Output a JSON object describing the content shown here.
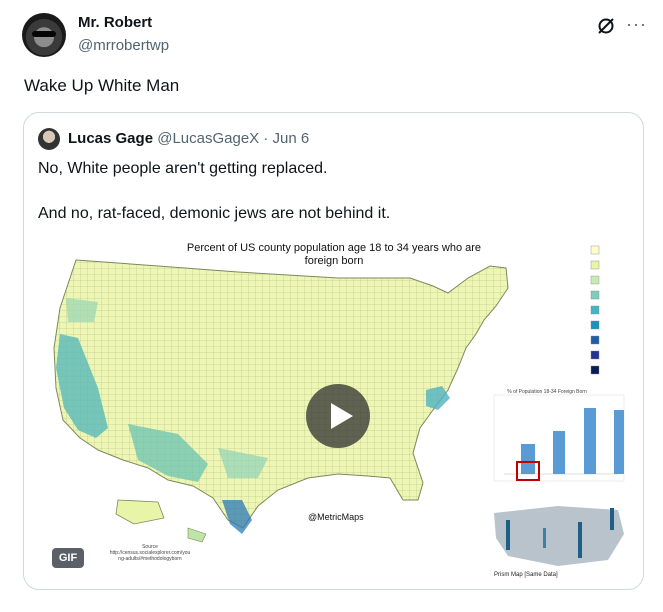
{
  "tweet": {
    "author_name": "Mr. Robert",
    "author_handle": "@mrrobertwp",
    "text": "Wake Up White Man",
    "more_label": "···"
  },
  "quote": {
    "author_name": "Lucas Gage",
    "author_handle": "@LucasGageX",
    "separator": " · ",
    "date": "Jun 6",
    "text_line1": "No, White people aren't getting replaced.",
    "text_line2": "And no, rat-faced, demonic jews are not behind it."
  },
  "media": {
    "title_line1": "Percent of US county population age 18 to 34 years who are",
    "title_line2": "foreign born",
    "credit": "@MetricMaps",
    "gif_label": "GIF",
    "source_line1": "Source",
    "source_line2": "http://census.socialexplorer.com/you",
    "source_line3": "ng-adults/#methodologyborn",
    "inset_title": "% of Population 18-34 Foreign Born",
    "prism_label": "Prism Map [Same Data]",
    "legend_colors": [
      "#ffffcc",
      "#e8f4a8",
      "#c7e9b4",
      "#7fcdbb",
      "#41b6c4",
      "#1d91c0",
      "#225ea8",
      "#253494",
      "#081d58"
    ]
  }
}
